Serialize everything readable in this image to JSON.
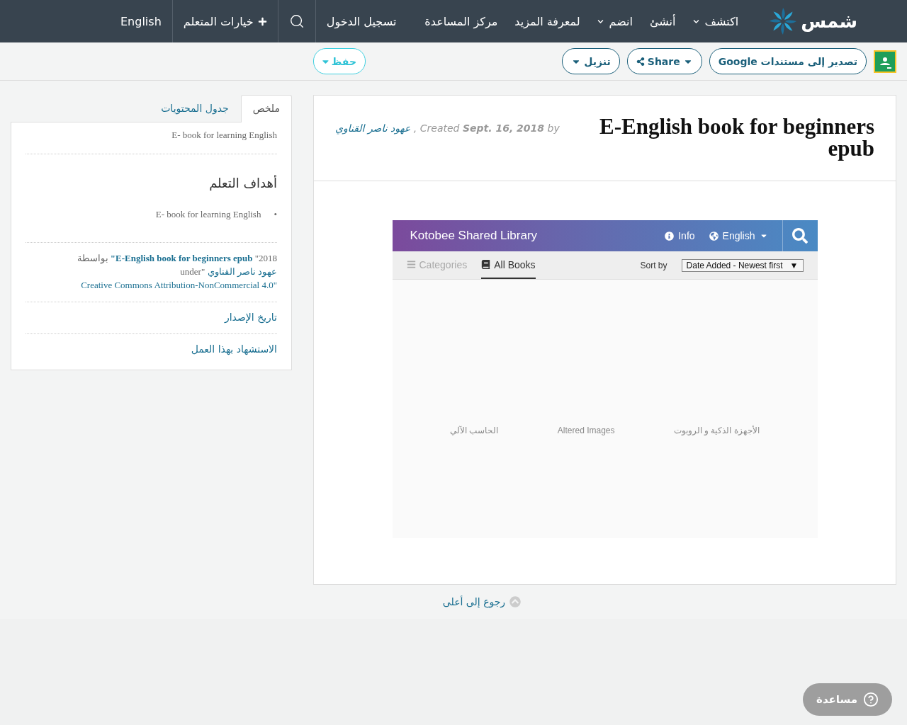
{
  "navbar": {
    "logo": "شمس",
    "items": [
      {
        "label": "اكتشف",
        "dropdown": true
      },
      {
        "label": "أنشئ",
        "dropdown": false
      },
      {
        "label": "انضم",
        "dropdown": true
      },
      {
        "label": "لمعرفة المزيد",
        "dropdown": false
      },
      {
        "label": "مركز المساعدة",
        "dropdown": false
      }
    ],
    "login": "تسجيل الدخول",
    "learner_options": "خيارات المتعلم",
    "language": "English"
  },
  "toolbar": {
    "export": "تصدير إلى مستندات Google",
    "share": "Share",
    "download": "تنزيل",
    "save": "حفظ"
  },
  "resource": {
    "title": "E-English book for beginners epub",
    "meta": {
      "author": "عهود ناصر القناوي",
      "created": ", Created",
      "date": "Sept. 16, 2018",
      "by": "by"
    },
    "viewer": {
      "title": "Kotobee Shared Library",
      "info": "Info",
      "language": "English",
      "tabs": [
        {
          "kind": "book",
          "label": "All Books",
          "selected": true
        },
        {
          "kind": "list",
          "label": "Categories",
          "selected": false
        }
      ],
      "sort_label": "Sort by",
      "sort_value": "Date Added - Newest first",
      "sort_arrow": "▼",
      "categories": [
        "الأجهزة الذكية و الروبوت",
        "Altered Images",
        "الحاسب الآلي"
      ]
    }
  },
  "sidebar": {
    "tabs": [
      {
        "label": "ملخص",
        "selected": true
      },
      {
        "label": "جدول المحتويات",
        "selected": false
      }
    ],
    "summary": "E- book for learning English",
    "objectives_heading": "أهداف التعلم",
    "objectives": [
      {
        "bullet": "•",
        "text": "E- book for learning English"
      }
    ],
    "citation": [
      {
        "kind": "text",
        "text": "2018\""
      },
      {
        "kind": "title",
        "text": "E-English book for beginners epub\""
      },
      {
        "kind": "text",
        "text": "بواسطة"
      },
      {
        "kind": "link",
        "text": "عهود ناصر القناوي"
      },
      {
        "kind": "text",
        "text": "\"under"
      },
      {
        "kind": "link",
        "text": "\"Creative Commons Attribution-NonCommercial 4.0"
      }
    ],
    "links": [
      "تاريخ الإصدار",
      "الاستشهاد بهذا العمل"
    ]
  },
  "back_to_top": "رجوع إلى أعلى",
  "help": "مساعدة"
}
